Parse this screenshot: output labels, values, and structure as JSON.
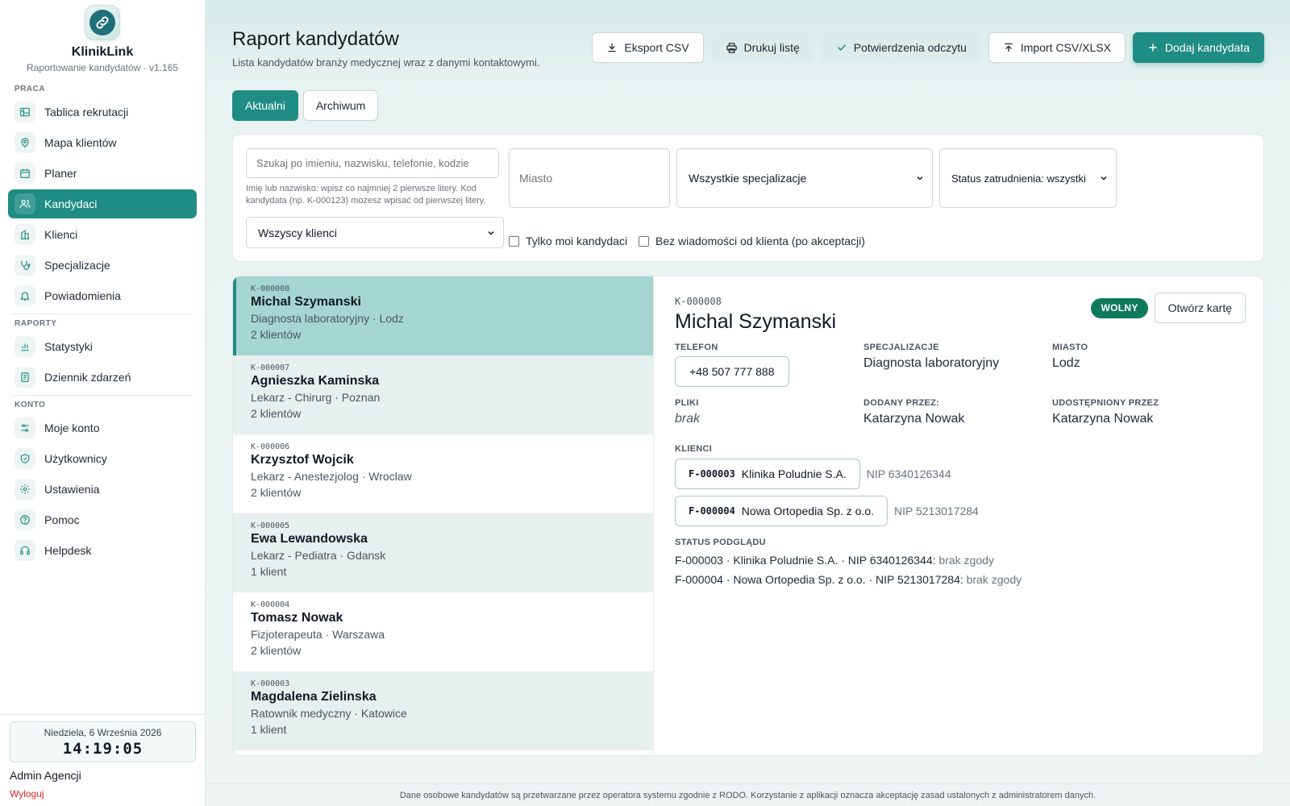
{
  "app": {
    "name": "KlinikLink",
    "subtitle": "Raportowanie kandydatów · v1.165"
  },
  "sidebar": {
    "sections": [
      {
        "title": "PRACA"
      },
      {
        "title": "RAPORTY"
      },
      {
        "title": "KONTO"
      }
    ],
    "items": [
      {
        "label": "Tablica rekrutacji",
        "icon": "board-icon"
      },
      {
        "label": "Mapa klientów",
        "icon": "map-pin-icon"
      },
      {
        "label": "Planer",
        "icon": "calendar-icon"
      },
      {
        "label": "Kandydaci",
        "icon": "users-icon",
        "active": true
      },
      {
        "label": "Klienci",
        "icon": "building-icon"
      },
      {
        "label": "Specjalizacje",
        "icon": "stethoscope-icon"
      },
      {
        "label": "Powiadomienia",
        "icon": "bell-icon"
      },
      {
        "label": "Statystyki",
        "icon": "bar-chart-icon"
      },
      {
        "label": "Dziennik zdarzeń",
        "icon": "log-icon"
      },
      {
        "label": "Moje konto",
        "icon": "sliders-icon"
      },
      {
        "label": "Użytkownicy",
        "icon": "shield-icon"
      },
      {
        "label": "Ustawienia",
        "icon": "gear-icon"
      },
      {
        "label": "Pomoc",
        "icon": "help-icon"
      },
      {
        "label": "Helpdesk",
        "icon": "headset-icon"
      }
    ],
    "clock": {
      "date": "Niedziela, 6 Września 2026",
      "time": "14:19:05"
    },
    "user": "Admin Agencji",
    "logout": "Wyloguj"
  },
  "header": {
    "title": "Raport kandydatów",
    "subtitle": "Lista kandydatów branży medycznej wraz z danymi kontaktowymi.",
    "buttons": {
      "export": "Eksport CSV",
      "print": "Drukuj listę",
      "confirm": "Potwierdzenia odczytu",
      "import": "Import CSV/XLSX",
      "add": "Dodaj kandydata"
    }
  },
  "tabs": {
    "current": "Aktualni",
    "archive": "Archiwum"
  },
  "filters": {
    "search_placeholder": "Szukaj po imieniu, nazwisku, telefonie, kodzie",
    "search_hint": "Imię lub nazwisko: wpisz co najmniej 2 pierwsze litery. Kod kandydata (np. K-000123) możesz wpisać od pierwszej litery.",
    "city_placeholder": "Miasto",
    "specialization": "Wszystkie specjalizacje",
    "status": "Status zatrudnienia: wszystki",
    "clients": "Wszyscy klienci",
    "only_mine": "Tylko moi kandydaci",
    "no_message": "Bez wiadomości od klienta (po akceptacji)"
  },
  "candidates": [
    {
      "id": "K-000008",
      "name": "Michal Szymanski",
      "meta": "Diagnosta laboratoryjny · Lodz",
      "count": "2 klientów"
    },
    {
      "id": "K-000007",
      "name": "Agnieszka Kaminska",
      "meta": "Lekarz - Chirurg · Poznan",
      "count": "2 klientów"
    },
    {
      "id": "K-000006",
      "name": "Krzysztof Wojcik",
      "meta": "Lekarz - Anestezjolog · Wroclaw",
      "count": "2 klientów"
    },
    {
      "id": "K-000005",
      "name": "Ewa Lewandowska",
      "meta": "Lekarz - Pediatra · Gdansk",
      "count": "1 klient"
    },
    {
      "id": "K-000004",
      "name": "Tomasz Nowak",
      "meta": "Fizjoterapeuta · Warszawa",
      "count": "2 klientów"
    },
    {
      "id": "K-000003",
      "name": "Magdalena Zielinska",
      "meta": "Ratownik medyczny · Katowice",
      "count": "1 klient"
    }
  ],
  "detail": {
    "id": "K-000008",
    "name": "Michal Szymanski",
    "badge": "WOLNY",
    "open_button": "Otwórz kartę",
    "labels": {
      "phone": "TELEFON",
      "specializations": "SPECJALIZACJE",
      "city": "MIASTO",
      "files": "PLIKI",
      "added_by": "DODANY PRZEZ:",
      "shared_by": "UDOSTĘPNIONY PRZEZ",
      "clients": "KLIENCI",
      "preview_status": "STATUS PODGLĄDU"
    },
    "phone": "+48 507 777 888",
    "specialization": "Diagnosta laboratoryjny",
    "city": "Lodz",
    "files": "brak",
    "added_by": "Katarzyna Nowak",
    "shared_by": "Katarzyna Nowak",
    "clients": [
      {
        "code": "F-000003",
        "name": "Klinika Poludnie S.A.",
        "nip": "NIP 6340126344"
      },
      {
        "code": "F-000004",
        "name": "Nowa Ortopedia Sp. z o.o.",
        "nip": "NIP 5213017284"
      }
    ],
    "preview": [
      {
        "text": "F-000003 · Klinika Poludnie S.A. · NIP 6340126344:",
        "status": "brak zgody"
      },
      {
        "text": "F-000004 · Nowa Ortopedia Sp. z o.o. · NIP 5213017284:",
        "status": "brak zgody"
      }
    ]
  },
  "footer": "Dane osobowe kandydatów są przetwarzane przez operatora systemu zgodnie z RODO. Korzystanie z aplikacji oznacza akceptację zasad ustalonych z administratorem danych.",
  "colors": {
    "accent": "#1f8d84",
    "selected_row": "#a5d6d2",
    "alt_row": "#e6f0ee",
    "badge": "#0f7a5a",
    "logout": "#dc2626"
  }
}
